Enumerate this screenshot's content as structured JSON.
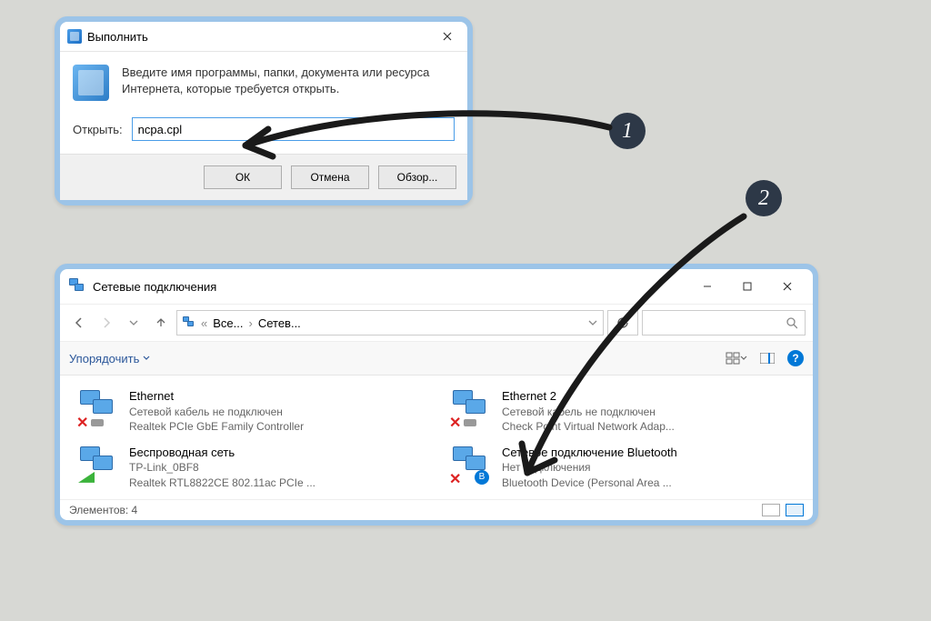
{
  "run": {
    "title": "Выполнить",
    "description": "Введите имя программы, папки, документа или ресурса Интернета, которые требуется открыть.",
    "open_label": "Открыть:",
    "input_value": "ncpa.cpl",
    "ok_label": "ОК",
    "cancel_label": "Отмена",
    "browse_label": "Обзор..."
  },
  "explorer": {
    "title": "Сетевые подключения",
    "breadcrumb_1": "Все...",
    "breadcrumb_2": "Сетев...",
    "organize_label": "Упорядочить",
    "connections": [
      {
        "name": "Ethernet",
        "status": "Сетевой кабель не подключен",
        "device": "Realtek PCIe GbE Family Controller"
      },
      {
        "name": "Ethernet 2",
        "status": "Сетевой кабель не подключен",
        "device": "Check Point Virtual Network Adap..."
      },
      {
        "name": "Беспроводная сеть",
        "status": "TP-Link_0BF8",
        "device": "Realtek RTL8822CE 802.11ac PCIe ..."
      },
      {
        "name": "Сетевое подключение Bluetooth",
        "status": "Нет подключения",
        "device": "Bluetooth Device (Personal Area ..."
      }
    ],
    "status_text": "Элементов: 4"
  },
  "annotations": {
    "step1": "1",
    "step2": "2"
  }
}
